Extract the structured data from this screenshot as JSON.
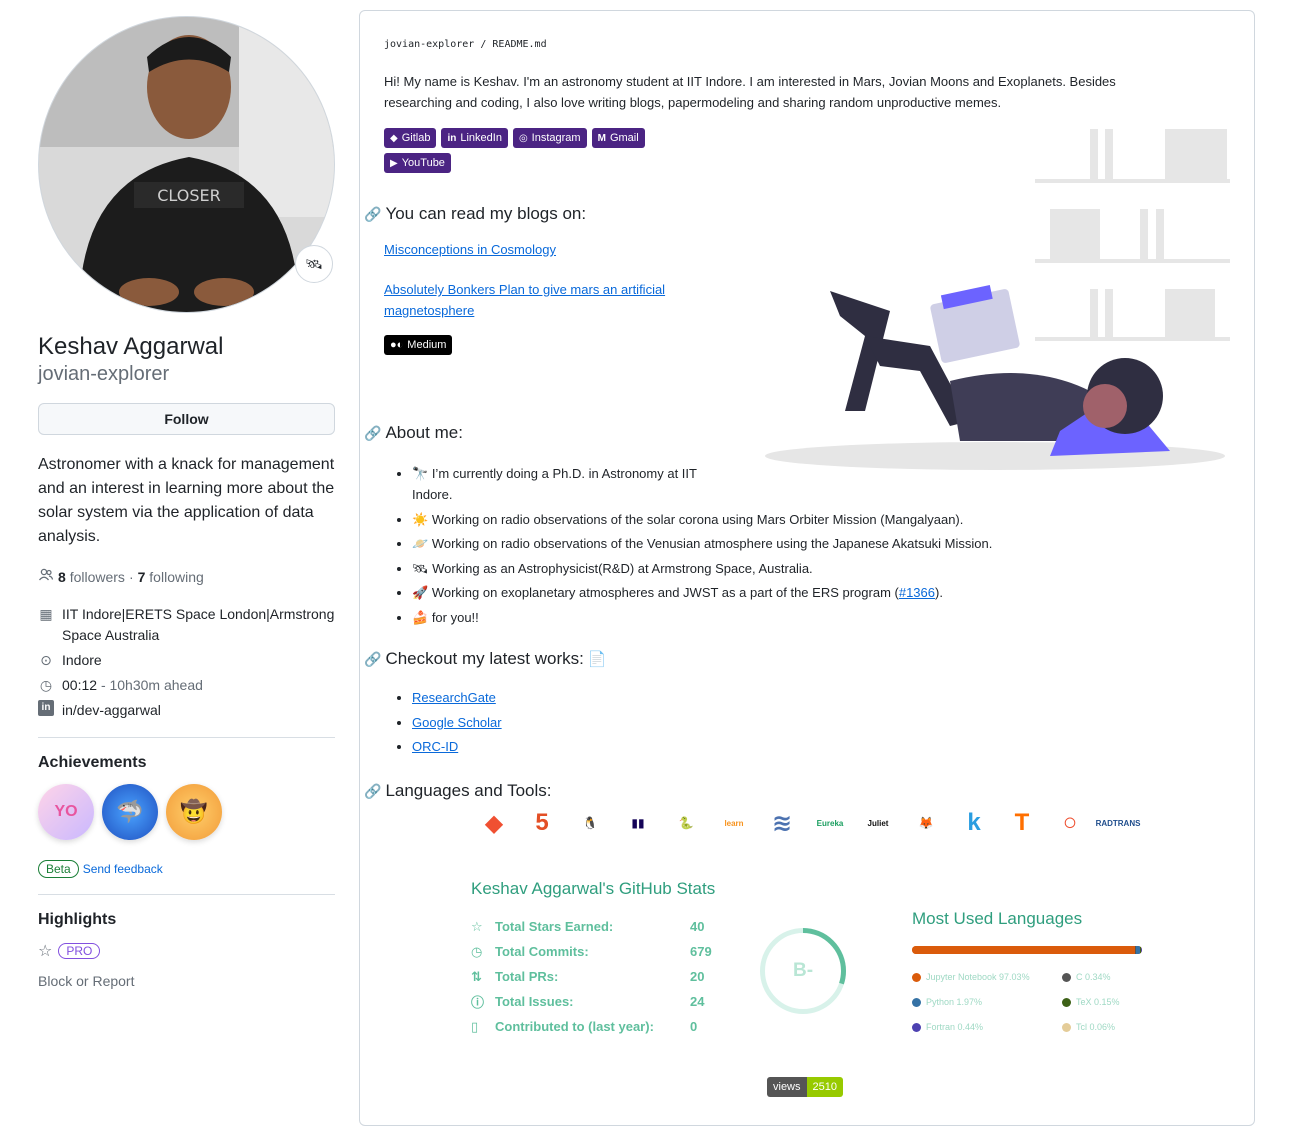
{
  "profile": {
    "name": "Keshav Aggarwal",
    "login": "jovian-explorer",
    "follow_label": "Follow",
    "bio": "Astronomer with a knack for management and an interest in learning more about the solar system via the application of data analysis.",
    "followers_count": "8",
    "followers_label": "followers",
    "following_count": "7",
    "following_label": "following",
    "separator": "·",
    "organization": "IIT Indore|ERETS Space London|Armstrong Space Australia",
    "location": "Indore",
    "local_time": "00:12",
    "time_ahead": "- 10h30m ahead",
    "linkedin": "in/dev-aggarwal"
  },
  "achievements": {
    "title": "Achievements",
    "badges": [
      "YOLO",
      "Pull Shark",
      "Quickdraw"
    ],
    "beta_label": "Beta",
    "feedback_label": "Send feedback"
  },
  "highlights": {
    "title": "Highlights",
    "pro_label": "PRO",
    "block_label": "Block or Report"
  },
  "readme": {
    "crumb_user": "jovian-explorer",
    "crumb_sep": "/",
    "crumb_file": "README.md",
    "intro": "Hi! My name is Keshav. I'm an astronomy student at IIT Indore. I am interested in Mars, Jovian Moons and Exoplanets. Besides researching and coding, I also love writing blogs, papermodeling and sharing random unproductive memes.",
    "socials": [
      {
        "label": "Gitlab",
        "icon": "gitlab-icon",
        "glyph": "◆"
      },
      {
        "label": "LinkedIn",
        "icon": "linkedin-icon",
        "glyph": "in"
      },
      {
        "label": "Instagram",
        "icon": "instagram-icon",
        "glyph": "◎"
      },
      {
        "label": "Gmail",
        "icon": "gmail-icon",
        "glyph": "M"
      },
      {
        "label": "YouTube",
        "icon": "youtube-icon",
        "glyph": "▶"
      }
    ],
    "blogs_heading": "You can read my blogs on:",
    "blog_links": [
      "Misconceptions in Cosmology",
      "Absolutely Bonkers Plan to give mars an artificial magnetosphere"
    ],
    "medium_label": "Medium",
    "about_heading": "About me:",
    "about_items": [
      {
        "emoji": "🔭",
        "text": "I’m currently doing a Ph.D. in Astronomy at IIT Indore."
      },
      {
        "emoji": "☀️",
        "text": "Working on radio observations of the solar corona using Mars Orbiter Mission (Mangalyaan)."
      },
      {
        "emoji": "🪐",
        "text": "Working on radio observations of the Venusian atmosphere using the Japanese Akatsuki Mission."
      },
      {
        "emoji": "🛰",
        "text": "Working as an Astrophysicist(R&D) at Armstrong Space, Australia."
      },
      {
        "emoji": "🚀",
        "text": "Working on exoplanetary atmospheres and JWST as a part of the ERS program ("
      },
      {
        "emoji": "🍰",
        "text": "for you!!"
      }
    ],
    "ers_link": "#1366",
    "ers_suffix": ").",
    "works_heading": "Checkout my latest works:",
    "works_links": [
      "ResearchGate",
      "Google Scholar",
      "ORC-ID"
    ],
    "tools_heading": "Languages and Tools:",
    "tools": [
      {
        "name": "git-icon",
        "glyph": "◆",
        "color": "#f05032"
      },
      {
        "name": "html5-icon",
        "glyph": "5",
        "color": "#e34f26"
      },
      {
        "name": "linux-icon",
        "glyph": "🐧",
        "color": "#000000"
      },
      {
        "name": "pandas-icon",
        "glyph": "▮▮",
        "color": "#150458"
      },
      {
        "name": "python-icon",
        "glyph": "🐍",
        "color": "#3776ab"
      },
      {
        "name": "scikit-learn-icon",
        "glyph": "learn",
        "color": "#f7931e"
      },
      {
        "name": "seaborn-icon",
        "glyph": "≋",
        "color": "#4c72b0"
      },
      {
        "name": "eureka-icon",
        "glyph": "Eureka",
        "color": "#1a9e5f"
      },
      {
        "name": "juliet-icon",
        "glyph": "Juliet",
        "color": "#111111"
      },
      {
        "name": "gitlab-tool-icon",
        "glyph": "🦊",
        "color": "#fc6d26"
      },
      {
        "name": "kotlin-icon",
        "glyph": "k",
        "color": "#2a9de0"
      },
      {
        "name": "tensorflow-icon",
        "glyph": "T",
        "color": "#ff6f00"
      },
      {
        "name": "pytorch-icon",
        "glyph": "○",
        "color": "#ee4c2c"
      },
      {
        "name": "radtrans-icon",
        "glyph": "RADTRANS",
        "color": "#1f4d8c"
      }
    ]
  },
  "stats": {
    "title": "Keshav Aggarwal's GitHub Stats",
    "rows": [
      {
        "icon": "star-icon",
        "glyph": "☆",
        "label": "Total Stars Earned:",
        "value": "40"
      },
      {
        "icon": "history-icon",
        "glyph": "◷",
        "label": "Total Commits:",
        "value": "679"
      },
      {
        "icon": "pull-request-icon",
        "glyph": "⇅",
        "label": "Total PRs:",
        "value": "20"
      },
      {
        "icon": "issue-icon",
        "glyph": "ⓘ",
        "label": "Total Issues:",
        "value": "24"
      },
      {
        "icon": "repo-icon",
        "glyph": "▯",
        "label": "Contributed to (last year):",
        "value": "0"
      }
    ],
    "grade": "B-",
    "grade_progress": 0.3,
    "colors": {
      "accent": "#2f9e7e",
      "ring": "#5fbf9d"
    }
  },
  "languages": {
    "title": "Most Used Languages",
    "items": [
      {
        "label": "Jupyter Notebook 97.03%",
        "color": "#DA5B0B",
        "percent": 97.03
      },
      {
        "label": "C 0.34%",
        "color": "#555555",
        "percent": 0.34
      },
      {
        "label": "Python 1.97%",
        "color": "#3572A5",
        "percent": 1.97
      },
      {
        "label": "TeX 0.15%",
        "color": "#3D6117",
        "percent": 0.15
      },
      {
        "label": "Fortran 0.44%",
        "color": "#4d41b1",
        "percent": 0.44
      },
      {
        "label": "Tcl 0.06%",
        "color": "#e4cc98",
        "percent": 0.06
      }
    ]
  },
  "views": {
    "label": "views",
    "count": "2510"
  }
}
